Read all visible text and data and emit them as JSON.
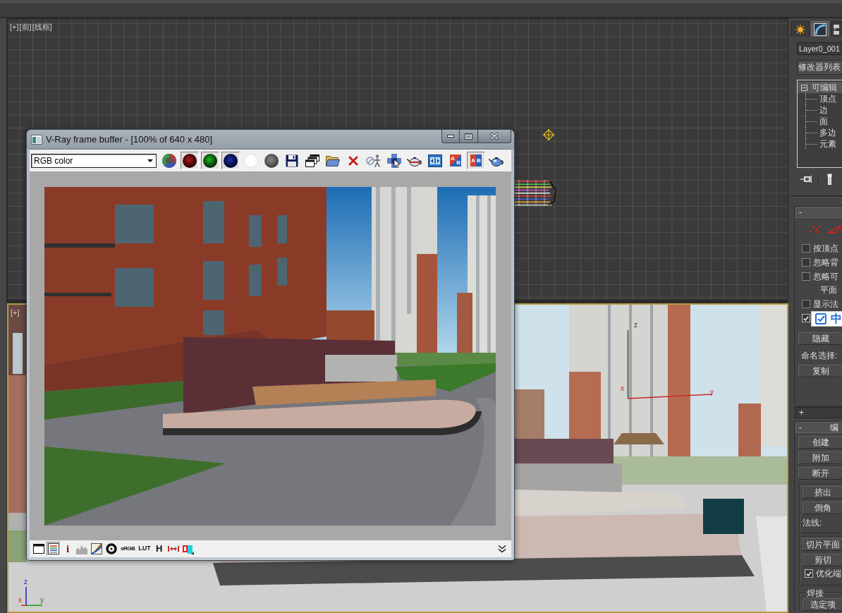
{
  "viewports": [
    {
      "kind": "wireframe",
      "active": false,
      "label": [
        "[+]",
        "[前]",
        "[线框]"
      ]
    },
    {
      "kind": "perspective",
      "active": true,
      "label": [
        "[+]"
      ],
      "gizmo_labels": {
        "z": "z",
        "x": "x",
        "y": "y"
      },
      "axis_labels": {
        "z": "z",
        "x": "x",
        "y": "y"
      }
    }
  ],
  "frame_buffer": {
    "title": "V-Ray frame buffer - [100% of 640 x 480]",
    "channel": "RGB color",
    "toolbar": [
      {
        "kind": "rgb",
        "on": false
      },
      {
        "kind": "red",
        "on": true
      },
      {
        "kind": "green",
        "on": true
      },
      {
        "kind": "blue",
        "on": true
      },
      {
        "kind": "mono",
        "on": false
      },
      {
        "kind": "alpha",
        "on": false
      },
      {
        "kind": "save",
        "on": false
      },
      {
        "kind": "clone",
        "on": false
      },
      {
        "kind": "load",
        "on": false
      },
      {
        "kind": "clear",
        "on": false
      },
      {
        "kind": "track",
        "on": false
      },
      {
        "kind": "region",
        "on": false
      },
      {
        "kind": "render",
        "on": false
      },
      {
        "kind": "stereo",
        "on": false
      },
      {
        "kind": "compare-diagonal",
        "on": false,
        "letters": [
          "A",
          "B"
        ]
      },
      {
        "kind": "compare-split",
        "on": true,
        "letters": [
          "A",
          "B"
        ]
      },
      {
        "kind": "teapot",
        "on": false
      }
    ],
    "bottom_toolbar": [
      {
        "kind": "window",
        "on": false
      },
      {
        "kind": "list",
        "on": true
      },
      {
        "kind": "info",
        "text": "i",
        "on": false
      },
      {
        "kind": "histogram",
        "on": false
      },
      {
        "kind": "curve",
        "on": false
      },
      {
        "kind": "ring",
        "on": false
      },
      {
        "kind": "srgb",
        "text": "sRGB",
        "on": false
      },
      {
        "kind": "lut",
        "text": "LUT",
        "on": false
      },
      {
        "kind": "history",
        "text": "H",
        "on": false
      },
      {
        "kind": "pixel-aspect",
        "on": false
      },
      {
        "kind": "anaglyph",
        "on": false
      }
    ]
  },
  "command_panel": {
    "tabs": [
      {
        "kind": "create",
        "selected": false
      },
      {
        "kind": "modify",
        "selected": true
      },
      {
        "kind": "hierarchy",
        "selected": false
      }
    ],
    "object_name": "Layer0_001",
    "modifier_list": "修改器列表",
    "stack": {
      "label": "可编辑",
      "expanded": true,
      "selected": true,
      "children": [
        {
          "label": "顶点",
          "selected": false
        },
        {
          "label": "边",
          "selected": false
        },
        {
          "label": "面",
          "selected": false
        },
        {
          "label": "多边",
          "selected": false
        },
        {
          "label": "元素",
          "selected": false
        }
      ]
    },
    "rollouts": [
      {
        "sign": "-",
        "expanded": true,
        "items": [
          {
            "kind": "selection-levels"
          },
          {
            "kind": "checkbox",
            "label": "按顶点",
            "checked": false
          },
          {
            "kind": "checkbox",
            "label": "忽略背",
            "checked": false
          },
          {
            "kind": "checkbox",
            "label": "忽略可",
            "checked": false
          },
          {
            "kind": "indented-label",
            "label": "平面"
          },
          {
            "kind": "checkbox",
            "label": "显示法",
            "checked": false
          },
          {
            "kind": "checkbox",
            "checked": true
          },
          {
            "kind": "button",
            "label": "隐藏"
          },
          {
            "kind": "label",
            "label": "命名选择:"
          },
          {
            "kind": "button",
            "label": "复制"
          }
        ]
      },
      {
        "sign": "+",
        "expanded": false
      },
      {
        "sign": "-",
        "title": "编",
        "expanded": true,
        "items": [
          {
            "kind": "button",
            "label": "创建"
          },
          {
            "kind": "button",
            "label": "附加"
          },
          {
            "kind": "button",
            "label": "断开"
          },
          {
            "kind": "group",
            "items": [
              {
                "kind": "button",
                "label": "挤出"
              },
              {
                "kind": "button",
                "label": "倒角"
              },
              {
                "kind": "label",
                "label": "法线:"
              }
            ]
          },
          {
            "kind": "group",
            "items": [
              {
                "kind": "button",
                "label": "切片平面"
              },
              {
                "kind": "button",
                "label": "剪切"
              },
              {
                "kind": "checkbox",
                "label": "优化端",
                "checked": true
              }
            ]
          },
          {
            "kind": "group",
            "title": "焊接",
            "items": [
              {
                "kind": "button",
                "label": "选定项"
              }
            ]
          }
        ]
      }
    ]
  },
  "ime_indicator": {
    "text": "中"
  }
}
